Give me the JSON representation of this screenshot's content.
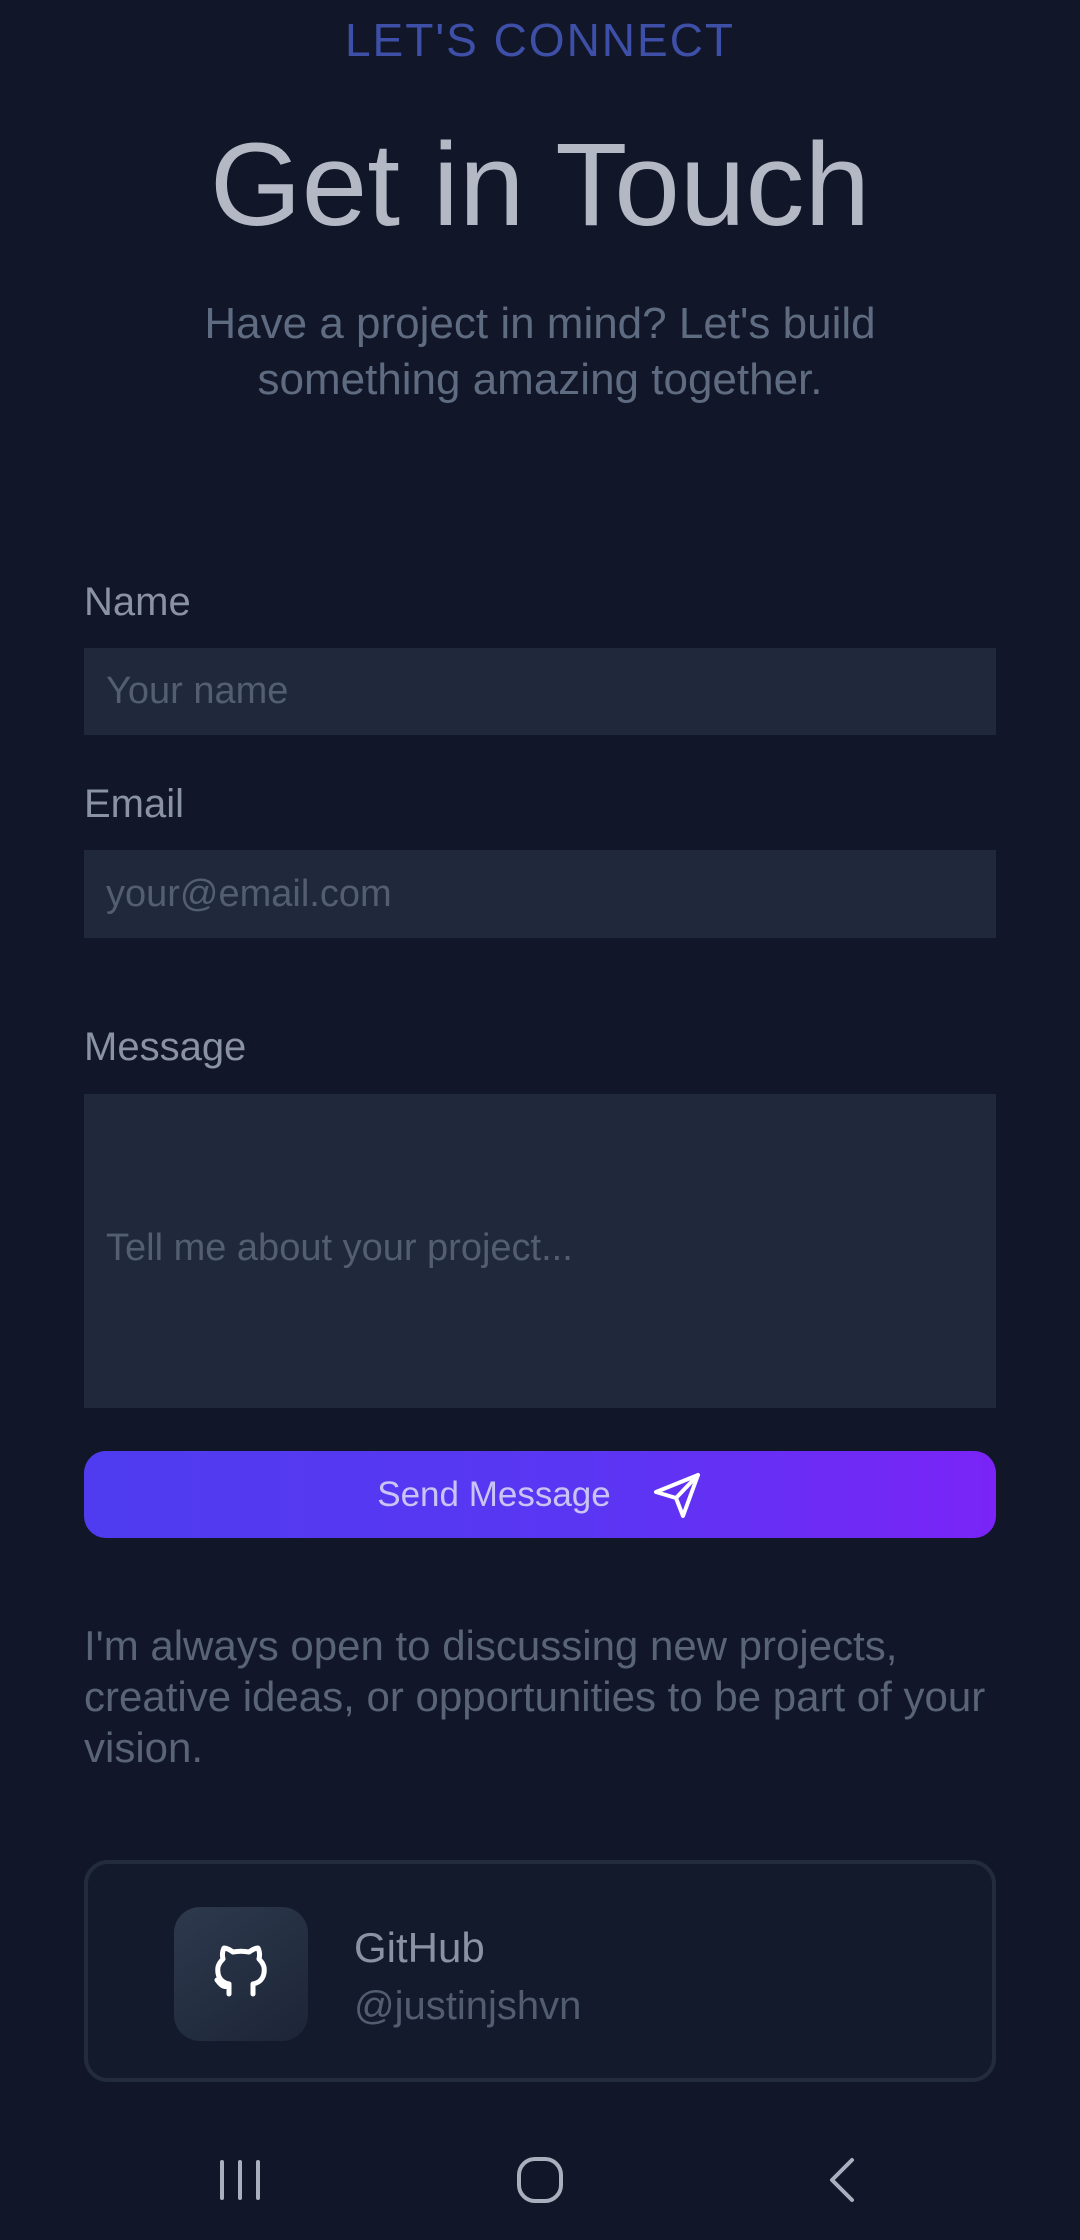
{
  "header": {
    "eyebrow": "LET'S CONNECT",
    "title": "Get in Touch",
    "subtitle": "Have a project in mind? Let's build something amazing together."
  },
  "form": {
    "name_label": "Name",
    "name_placeholder": "Your name",
    "email_label": "Email",
    "email_placeholder": "your@email.com",
    "message_label": "Message",
    "message_placeholder": "Tell me about your project...",
    "submit_label": "Send Message",
    "submit_icon": "send-icon"
  },
  "blurb": "I'm always open to discussing new projects, creative ideas, or opportunities to be part of your vision.",
  "social": {
    "name": "GitHub",
    "handle": "@justinjshvn",
    "icon": "github-icon"
  },
  "navigation_bar": {
    "recent_icon": "recent-apps-icon",
    "home_icon": "home-icon",
    "back_icon": "back-icon"
  },
  "colors": {
    "background": "#111729",
    "accent": "#3e4fa8",
    "button_gradient_start": "#4f3cf0",
    "button_gradient_end": "#7a24f7",
    "field_background": "#1f293b"
  }
}
